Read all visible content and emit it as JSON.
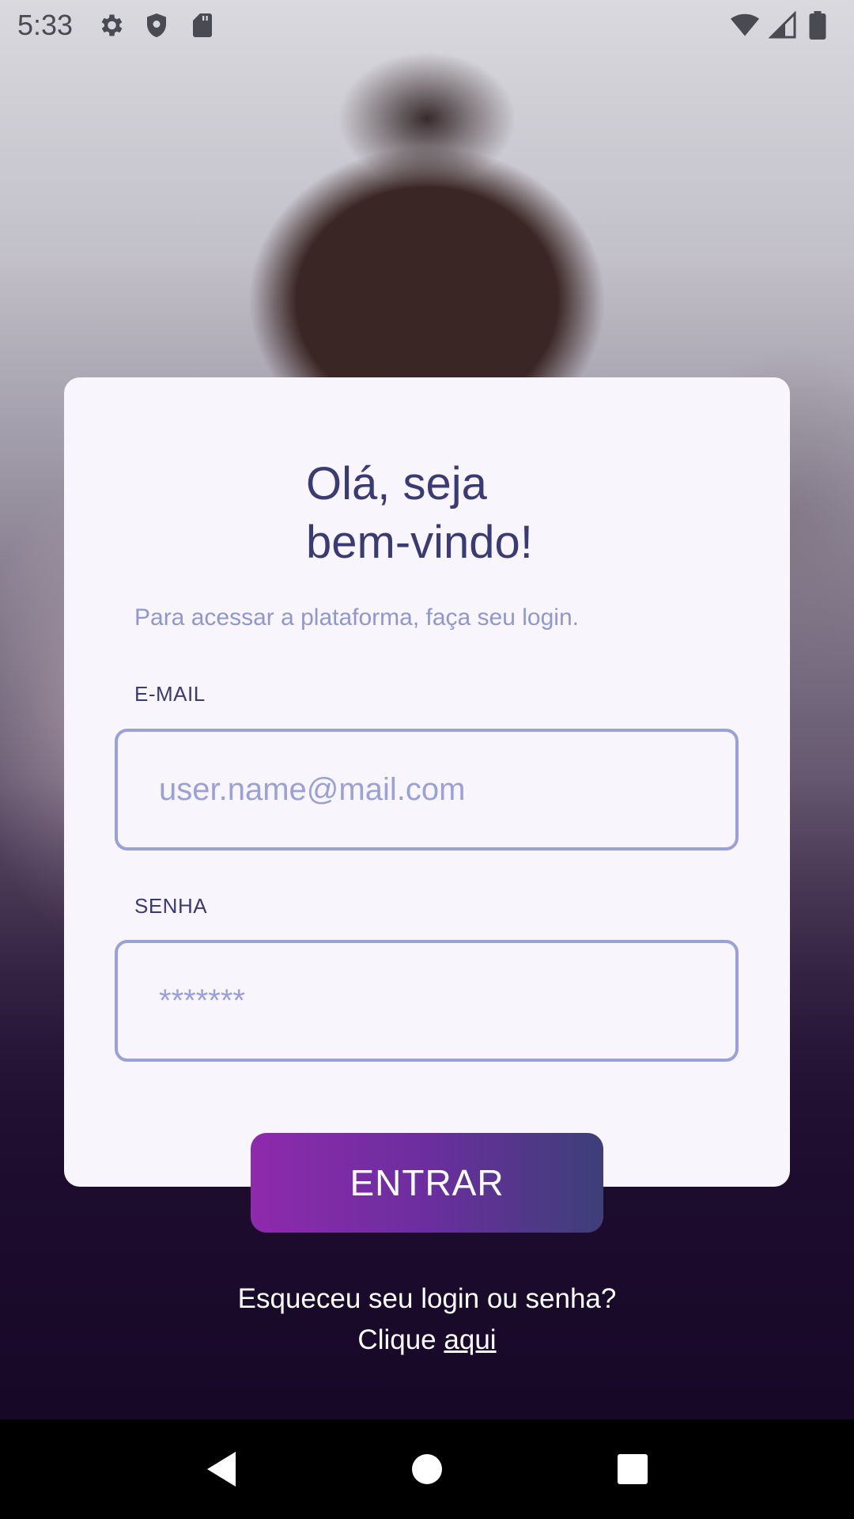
{
  "status_bar": {
    "time": "5:33",
    "left_icons": [
      "gear-icon",
      "shield-icon",
      "sd-card-icon"
    ],
    "right_icons": [
      "wifi-icon",
      "signal-icon",
      "battery-icon"
    ]
  },
  "login_card": {
    "title_line1": "Olá, seja",
    "title_line2": "bem-vindo!",
    "subtitle": "Para acessar a plataforma, faça seu login.",
    "email_label": "E-MAIL",
    "email_placeholder": "user.name@mail.com",
    "email_value": "",
    "password_label": "SENHA",
    "password_placeholder": "*******",
    "password_value": ""
  },
  "enter_button_label": "ENTRAR",
  "forgot": {
    "line1": "Esqueceu seu login ou senha?",
    "prefix": "Clique",
    "link": "aqui"
  },
  "nav_bar": {
    "buttons": [
      "back-icon",
      "home-icon",
      "recents-icon"
    ]
  },
  "colors": {
    "card_bg": "#f8f5fd",
    "title": "#3a3b72",
    "accent_light": "#9aa0d8",
    "button_start": "#8e2aad",
    "button_end": "#3d3f78"
  }
}
